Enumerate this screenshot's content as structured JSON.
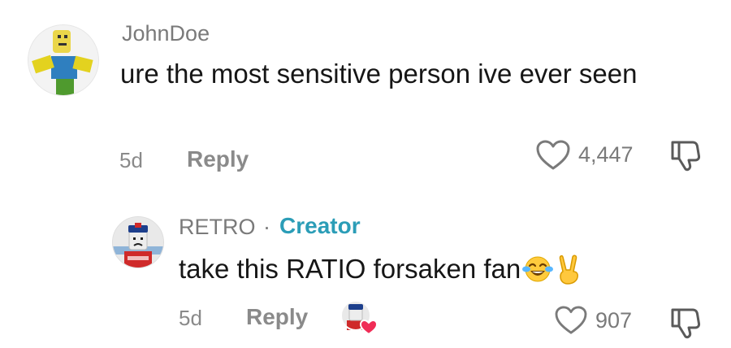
{
  "comments": [
    {
      "username": "JohnDoe",
      "text": "ure the most sensitive person ive ever seen",
      "time": "5d",
      "reply_label": "Reply",
      "like_count": "4,447",
      "avatar_icon": "roblox-noob-avatar"
    },
    {
      "username": "RETRO",
      "separator": "·",
      "badge": "Creator",
      "text": "take this RATIO forsaken fan",
      "emojis": [
        "face-with-tears-of-joy",
        "victory-hand"
      ],
      "time": "5d",
      "reply_label": "Reply",
      "like_count": "907",
      "avatar_icon": "roblox-character-avatar",
      "creator_liked_icon": "creator-liked-heart-icon"
    }
  ],
  "colors": {
    "text_primary": "#161616",
    "text_secondary": "#7a7a7a",
    "creator_badge": "#2b9db7",
    "creator_heart": "#f02c56"
  }
}
